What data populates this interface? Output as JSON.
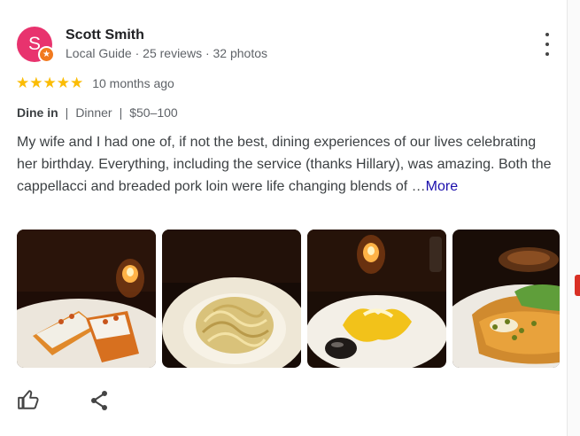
{
  "review": {
    "author_initial": "S",
    "author_name": "Scott Smith",
    "author_meta": "Local Guide · 25 reviews · 32 photos",
    "stars": "★★★★★",
    "rating": 5,
    "time_ago": "10 months ago",
    "service_type": "Dine in",
    "meal_type": "Dinner",
    "price_range": "$50–100",
    "separator": "|",
    "text": "My wife and I had one of, if not the best, dining experiences of our lives celebrating her birthday. Everything, including the service (thanks Hillary), was amazing. Both the cappellacci and breaded pork loin were life changing blends of",
    "ellipsis": "…",
    "more_label": "More"
  },
  "photos": [
    {
      "subject": "toast-appetizer-photo"
    },
    {
      "subject": "pasta-plate-photo"
    },
    {
      "subject": "cappellacci-plate-photo"
    },
    {
      "subject": "breaded-pork-loin-photo"
    }
  ],
  "icons": {
    "menu": "more-vert-icon",
    "like": "thumb-up-icon",
    "share": "share-icon",
    "badge": "local-guide-star-icon"
  },
  "colors": {
    "avatar": "#e8336e",
    "badge": "#f17a1f",
    "stars": "#fbbc04",
    "link": "#1a0dab"
  }
}
